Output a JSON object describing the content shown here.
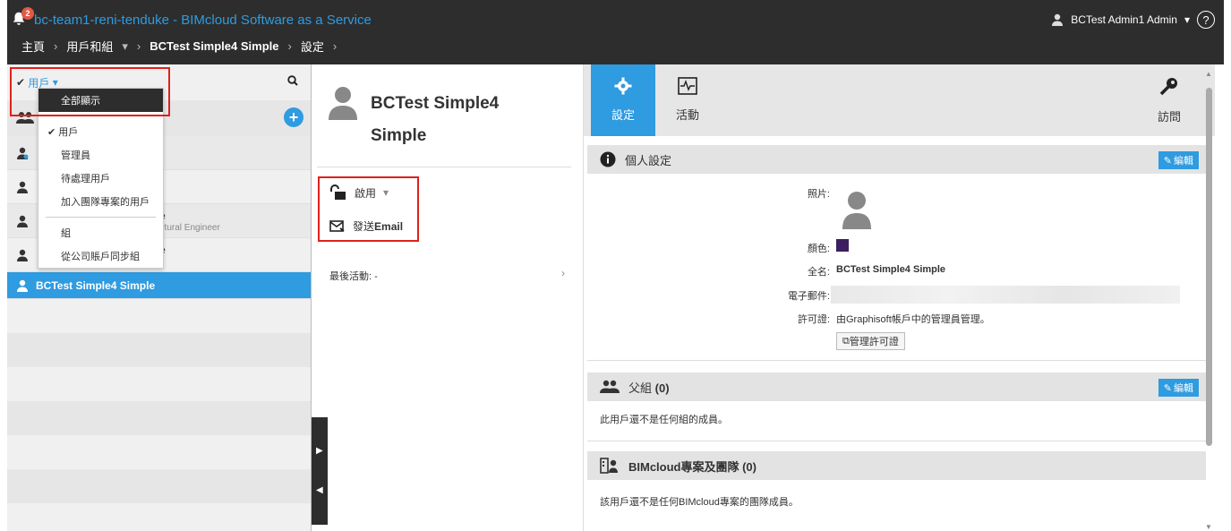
{
  "header": {
    "notification_count": "2",
    "app_title": "bc-team1-reni-tenduke - BIMcloud Software as a Service",
    "user_name": "BCTest Admin1 Admin",
    "help_glyph": "?"
  },
  "breadcrumb": {
    "home": "主頁",
    "users_groups": "用戶和組",
    "current_user": "BCTest Simple4 Simple",
    "settings": "設定"
  },
  "left": {
    "filter_label": "用戶",
    "search_icon": "search-icon",
    "partial_rows": [
      {
        "trail": "",
        "sub": ""
      },
      {
        "trail": "",
        "sub": ""
      },
      {
        "trail": "e",
        "sub": "uctural Engineer"
      },
      {
        "trail": "e",
        "sub": ""
      }
    ],
    "selected_user": "BCTest Simple4 Simple"
  },
  "dropdown": {
    "show_all": "全部顯示",
    "users": "用戶",
    "admins": "管理員",
    "pending_users": "待處理用戶",
    "team_project_users": "加入團隊專案的用戶",
    "groups": "組",
    "sync_groups": "從公司賬戶同步組"
  },
  "middle": {
    "name": "BCTest Simple4 Simple",
    "enable_label": "啟用",
    "send_email_prefix": "發送",
    "send_email_bold": "Email",
    "last_activity": "最後活動: -"
  },
  "tabs": {
    "settings": "設定",
    "activity": "活動",
    "access": "訪問"
  },
  "personal": {
    "header": "個人設定",
    "edit": "編輯",
    "photo_label": "照片:",
    "color_label": "顏色:",
    "color_value": "#3c1f5e",
    "fullname_label": "全名:",
    "fullname_value": "BCTest Simple4 Simple",
    "email_label": "電子郵件:",
    "license_label": "許可證:",
    "license_value": "由Graphisoft帳戶中的管理員管理。",
    "manage_license": "管理許可證"
  },
  "parent_groups": {
    "header_prefix": "父組",
    "header_count": "(0)",
    "edit": "編輯",
    "empty_text": "此用戶還不是任何組的成員。"
  },
  "projects": {
    "header": "BIMcloud專案及團隊 (0)",
    "empty_text": "該用戶還不是任何BIMcloud專案的團隊成員。"
  }
}
